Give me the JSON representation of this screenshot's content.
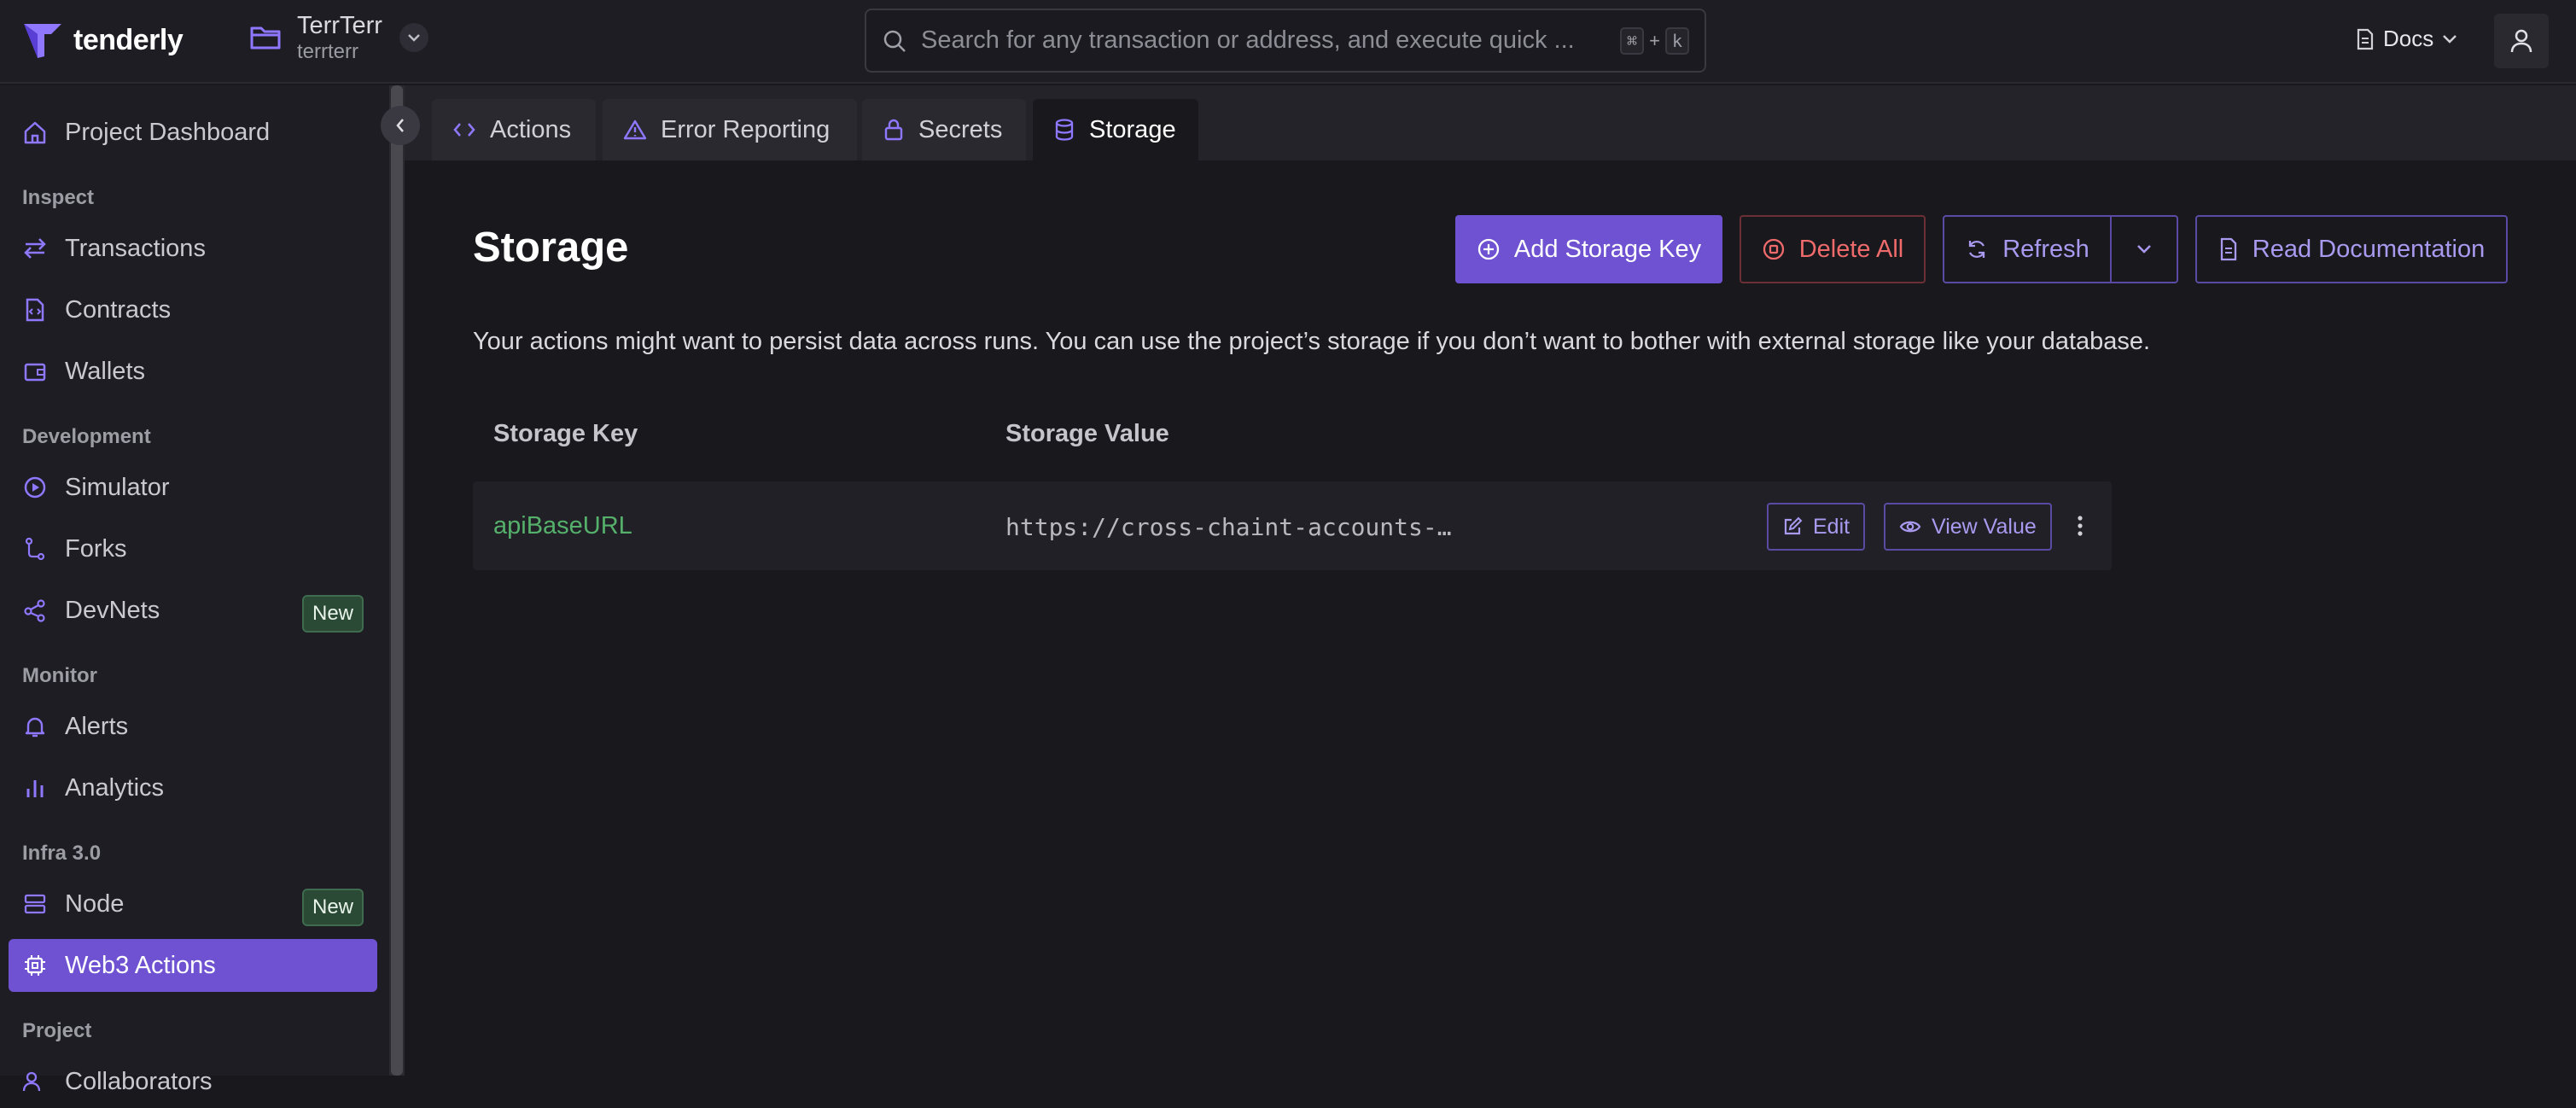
{
  "app": {
    "logo_text": "tenderly"
  },
  "project": {
    "name": "TerrTerr",
    "slug": "terrterr"
  },
  "search": {
    "placeholder": "Search for any transaction or address, and execute quick ...",
    "shortcut_mod": "⌘",
    "shortcut_plus": "+",
    "shortcut_key": "k"
  },
  "header": {
    "docs_label": "Docs"
  },
  "sidebar": {
    "top_item": "Project Dashboard",
    "sections": {
      "inspect": "Inspect",
      "development": "Development",
      "monitor": "Monitor",
      "infra": "Infra 3.0",
      "project": "Project"
    },
    "items": {
      "transactions": "Transactions",
      "contracts": "Contracts",
      "wallets": "Wallets",
      "simulator": "Simulator",
      "forks": "Forks",
      "devnets": "DevNets",
      "alerts": "Alerts",
      "analytics": "Analytics",
      "node": "Node",
      "web3actions": "Web3 Actions",
      "collaborators": "Collaborators"
    },
    "badge_new": "New"
  },
  "tabs": {
    "actions": "Actions",
    "error_reporting": "Error Reporting",
    "secrets": "Secrets",
    "storage": "Storage"
  },
  "page": {
    "title": "Storage",
    "description": "Your actions might want to persist data across runs. You can use the project’s storage if you don’t want to bother with external storage like your database.",
    "buttons": {
      "add": "Add Storage Key",
      "delete_all": "Delete All",
      "refresh": "Refresh",
      "read_docs": "Read Documentation"
    }
  },
  "table": {
    "columns": [
      "Storage Key",
      "Storage Value"
    ],
    "rows": [
      {
        "key": "apiBaseURL",
        "value": "https://cross-chaint-accounts-…",
        "edit_label": "Edit",
        "view_label": "View Value"
      }
    ]
  },
  "colors": {
    "accent": "#6e52d1",
    "danger": "#ef6b6b",
    "key_green": "#55b06b",
    "background": "#19181d"
  }
}
